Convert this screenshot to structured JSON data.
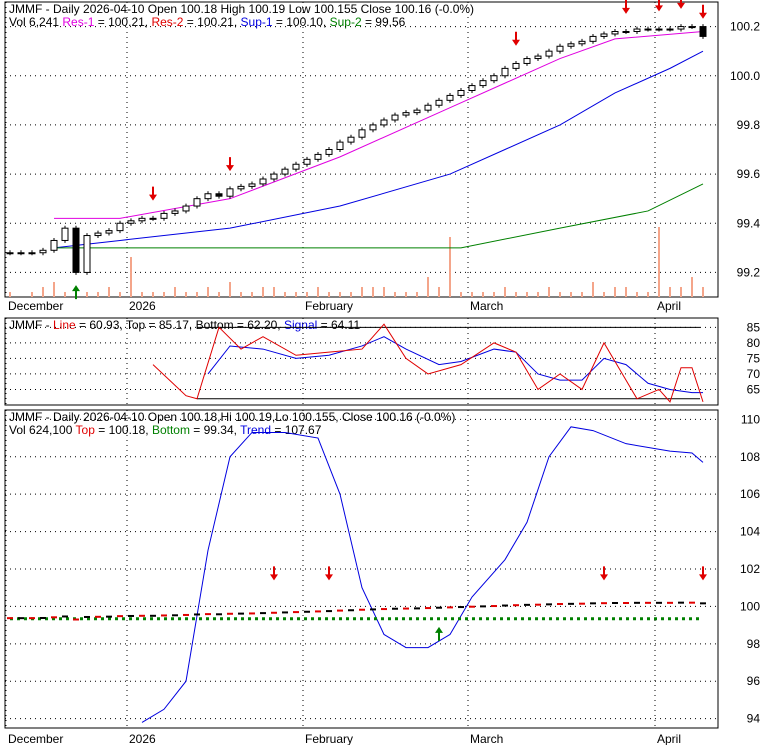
{
  "chart_data": [
    {
      "type": "candlestick",
      "panel": "price",
      "title_parts": {
        "symbol": "JMMF",
        "period": "Daily",
        "date": "2026-04-10",
        "open": "Open 100.18",
        "high": "High 100.19",
        "low": "Low 100.155",
        "close": "Close 100.16 (-0.0%)"
      },
      "legend": {
        "vol": "Vol 6,241",
        "res1": "Res-1",
        "res1_val": " = 100.21, ",
        "res2": "Res-2",
        "res2_val": " = 100.21, ",
        "sup1": "Sup-1",
        "sup1_val": " = 100.10, ",
        "sup2": "Sup-2",
        "sup2_val": " = 99.56"
      },
      "ylim": [
        99.1,
        100.3
      ],
      "yticks": [
        "100.2",
        "100.0",
        "99.8",
        "99.6",
        "99.4",
        "99.2"
      ],
      "ytick_values": [
        100.2,
        100.0,
        99.8,
        99.6,
        99.4,
        99.2
      ],
      "xticks": [
        "December",
        "2026",
        "February",
        "March",
        "April"
      ],
      "xtick_index": [
        0,
        11,
        27,
        42,
        59
      ],
      "closes": [
        99.28,
        99.28,
        99.28,
        99.29,
        99.33,
        99.38,
        99.2,
        99.35,
        99.36,
        99.37,
        99.4,
        99.41,
        99.42,
        99.42,
        99.44,
        99.45,
        99.47,
        99.5,
        99.52,
        99.51,
        99.54,
        99.55,
        99.56,
        99.58,
        99.6,
        99.62,
        99.64,
        99.66,
        99.68,
        99.7,
        99.73,
        99.75,
        99.78,
        99.8,
        99.82,
        99.84,
        99.85,
        99.86,
        99.88,
        99.9,
        99.92,
        99.94,
        99.96,
        99.98,
        100.0,
        100.03,
        100.05,
        100.07,
        100.08,
        100.1,
        100.12,
        100.13,
        100.14,
        100.16,
        100.17,
        100.18,
        100.18,
        100.19,
        100.19,
        100.19,
        100.19,
        100.2,
        100.2,
        100.16
      ],
      "volume": [
        1,
        0,
        1,
        2,
        3,
        1,
        2,
        1,
        1,
        2,
        1,
        8,
        1,
        1,
        1,
        2,
        1,
        1,
        2,
        1,
        3,
        1,
        1,
        2,
        2,
        1,
        1,
        1,
        2,
        1,
        1,
        1,
        2,
        2,
        2,
        1,
        1,
        1,
        4,
        2,
        12,
        1,
        1,
        1,
        1,
        2,
        1,
        1,
        1,
        2,
        1,
        1,
        1,
        3,
        1,
        2,
        2,
        1,
        1,
        14,
        2,
        2,
        4,
        2
      ],
      "ma_short": [
        [
          4,
          99.42
        ],
        [
          10,
          99.42
        ],
        [
          20,
          99.5
        ],
        [
          30,
          99.67
        ],
        [
          40,
          99.87
        ],
        [
          45,
          99.97
        ],
        [
          50,
          100.07
        ],
        [
          55,
          100.15
        ],
        [
          63,
          100.18
        ]
      ],
      "ma_mid": [
        [
          4,
          99.3
        ],
        [
          10,
          99.33
        ],
        [
          20,
          99.38
        ],
        [
          30,
          99.47
        ],
        [
          40,
          99.6
        ],
        [
          45,
          99.7
        ],
        [
          50,
          99.8
        ],
        [
          55,
          99.93
        ],
        [
          60,
          100.03
        ],
        [
          63,
          100.1
        ]
      ],
      "ma_long": [
        [
          4,
          99.3
        ],
        [
          41,
          99.3
        ],
        [
          50,
          99.38
        ],
        [
          58,
          99.45
        ],
        [
          63,
          99.56
        ]
      ],
      "down_arrows": [
        13,
        20,
        46,
        56,
        59,
        61,
        63
      ],
      "up_arrows": [
        6
      ]
    },
    {
      "type": "line",
      "panel": "oscillator",
      "legend": {
        "symbol": "JMMF - ",
        "line": "Line",
        "line_val": " = 60.93, ",
        "top_bottom": "Top = 85.17, Bottom = 62.20, ",
        "signal": "Signal",
        "signal_val": " = 64.11"
      },
      "ylim": [
        60,
        88
      ],
      "yticks": [
        "85",
        "80",
        "75",
        "70",
        "65"
      ],
      "ytick_values": [
        85,
        80,
        75,
        70,
        65
      ],
      "line": [
        [
          13,
          73
        ],
        [
          16,
          63
        ],
        [
          17,
          62
        ],
        [
          19,
          85
        ],
        [
          21,
          78
        ],
        [
          23,
          82
        ],
        [
          26,
          76
        ],
        [
          29,
          77
        ],
        [
          32,
          78
        ],
        [
          34,
          86
        ],
        [
          36,
          75
        ],
        [
          38,
          70
        ],
        [
          41,
          73
        ],
        [
          44,
          80
        ],
        [
          46,
          77
        ],
        [
          48,
          65
        ],
        [
          50,
          70
        ],
        [
          52,
          65
        ],
        [
          54,
          80
        ],
        [
          56,
          68
        ],
        [
          57,
          62
        ],
        [
          59,
          65
        ],
        [
          60,
          61
        ],
        [
          61,
          72
        ],
        [
          62,
          72
        ],
        [
          63,
          61
        ]
      ],
      "signal": [
        [
          18,
          70
        ],
        [
          20,
          79
        ],
        [
          23,
          78
        ],
        [
          26,
          75
        ],
        [
          29,
          76
        ],
        [
          32,
          79
        ],
        [
          34,
          82
        ],
        [
          36,
          78
        ],
        [
          39,
          73
        ],
        [
          41,
          74
        ],
        [
          44,
          78
        ],
        [
          46,
          77
        ],
        [
          48,
          70
        ],
        [
          50,
          68
        ],
        [
          52,
          68
        ],
        [
          54,
          75
        ],
        [
          56,
          73
        ],
        [
          58,
          67
        ],
        [
          60,
          65
        ],
        [
          62,
          64
        ],
        [
          63,
          64
        ]
      ]
    },
    {
      "type": "line",
      "panel": "trend",
      "title_parts": {
        "symbol": "JMMF",
        "period": "Daily",
        "date": "2026-04-10",
        "open": "Open 100.18",
        "high": "Hi 100.19",
        "low": "Lo 100.155",
        "close": "Close 100.16 (-0.0%)"
      },
      "legend": {
        "vol": "Vol 624,100",
        "top": "Top",
        "top_val": " = 100.18, ",
        "bottom": "Bottom",
        "bottom_val": " = 99.34, ",
        "trend": "Trend",
        "trend_val": " = 107.67"
      },
      "ylim": [
        93.5,
        110.5
      ],
      "yticks": [
        "110",
        "108",
        "106",
        "104",
        "102",
        "100",
        "98",
        "96",
        "94"
      ],
      "ytick_values": [
        110,
        108,
        106,
        104,
        102,
        100,
        98,
        96,
        94
      ],
      "trend": [
        [
          12,
          93.8
        ],
        [
          14,
          94.5
        ],
        [
          16,
          96
        ],
        [
          18,
          103
        ],
        [
          20,
          108
        ],
        [
          22,
          109.3
        ],
        [
          25,
          109.3
        ],
        [
          28,
          109
        ],
        [
          30,
          106
        ],
        [
          32,
          101
        ],
        [
          34,
          98.5
        ],
        [
          36,
          97.8
        ],
        [
          38,
          97.8
        ],
        [
          40,
          98.5
        ],
        [
          42,
          100.5
        ],
        [
          45,
          102.5
        ],
        [
          47,
          104.5
        ],
        [
          49,
          108
        ],
        [
          51,
          109.6
        ],
        [
          53,
          109.4
        ],
        [
          56,
          108.7
        ],
        [
          60,
          108.3
        ],
        [
          62,
          108.2
        ],
        [
          63,
          107.7
        ]
      ],
      "top_value": 100.18,
      "bottom_value": 99.34,
      "down_arrows": [
        24,
        29,
        54,
        63
      ],
      "up_arrows": [
        39
      ]
    }
  ]
}
